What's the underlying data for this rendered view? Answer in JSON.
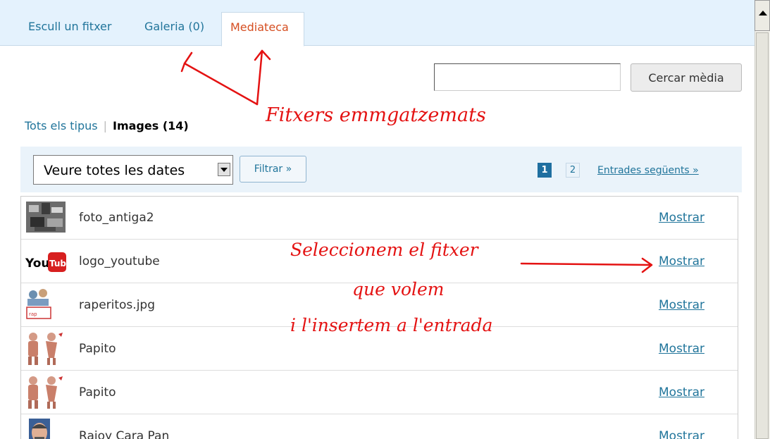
{
  "tabs": [
    {
      "label": "Escull un fitxer",
      "active": false
    },
    {
      "label": "Galeria (0)",
      "active": false
    },
    {
      "label": "Mediateca",
      "active": true
    }
  ],
  "search": {
    "value": "",
    "button_label": "Cercar mèdia"
  },
  "type_filter": {
    "all_label": "Tots els tipus",
    "separator": "|",
    "current_label": "Images (14)"
  },
  "date_filter": {
    "selected": "Veure totes les dates",
    "button_label": "Filtrar »"
  },
  "pagination": {
    "pages": [
      "1",
      "2"
    ],
    "current_page": "1",
    "next_label": "Entrades següents »"
  },
  "media": [
    {
      "title": "foto_antiga2",
      "action": "Mostrar",
      "thumb": "old-photo-thumbnail"
    },
    {
      "title": "logo_youtube",
      "action": "Mostrar",
      "thumb": "youtube-logo-thumbnail"
    },
    {
      "title": "raperitos.jpg",
      "action": "Mostrar",
      "thumb": "cartoon-thumbnail"
    },
    {
      "title": "Papito",
      "action": "Mostrar",
      "thumb": "figures-thumbnail"
    },
    {
      "title": "Papito",
      "action": "Mostrar",
      "thumb": "figures-thumbnail"
    },
    {
      "title": "Rajoy Cara Pan",
      "action": "Mostrar",
      "thumb": "face-thumbnail"
    }
  ],
  "annotations": {
    "stored_files": "Fitxers emmgatzemats",
    "select_line1": "Seleccionem el fitxer",
    "select_line2": "que volem",
    "select_line3": "i l'insertem a l'entrada"
  },
  "colors": {
    "link": "#21759b",
    "active_tab": "#d54e21",
    "annotation": "#e41212",
    "tab_bar": "#e4f2fd"
  }
}
